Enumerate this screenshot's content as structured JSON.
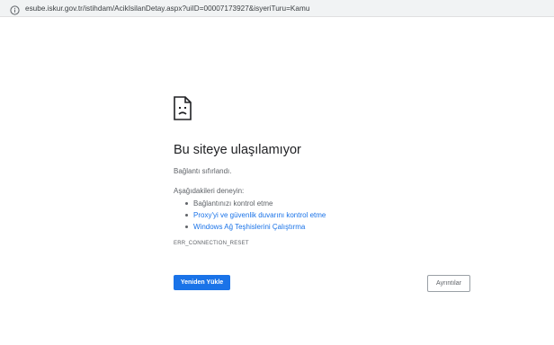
{
  "address_bar": {
    "icon": "info-icon",
    "url": "esube.iskur.gov.tr/istihdam/AcikIsilanDetay.aspx?uiID=00007173927&isyeriTuru=Kamu"
  },
  "error_page": {
    "icon": "sad-page-icon",
    "title": "Bu siteye ulaşılamıyor",
    "subtitle": "Bağlantı sıfırlandı.",
    "try_label": "Aşağıdakileri deneyin:",
    "suggestions": [
      {
        "label": "Bağlantınızı kontrol etme",
        "link": false
      },
      {
        "label": "Proxy'yi ve güvenlik duvarını kontrol etme",
        "link": true
      },
      {
        "label": "Windows Ağ Teşhislerini Çalıştırma",
        "link": true
      }
    ],
    "error_code": "ERR_CONNECTION_RESET",
    "reload_label": "Yeniden Yükle",
    "details_label": "Ayrıntılar"
  },
  "colors": {
    "accent": "#1a73e8",
    "text": "#202124",
    "secondary_text": "#5f6368",
    "address_bar_bg": "#f1f3f4"
  }
}
